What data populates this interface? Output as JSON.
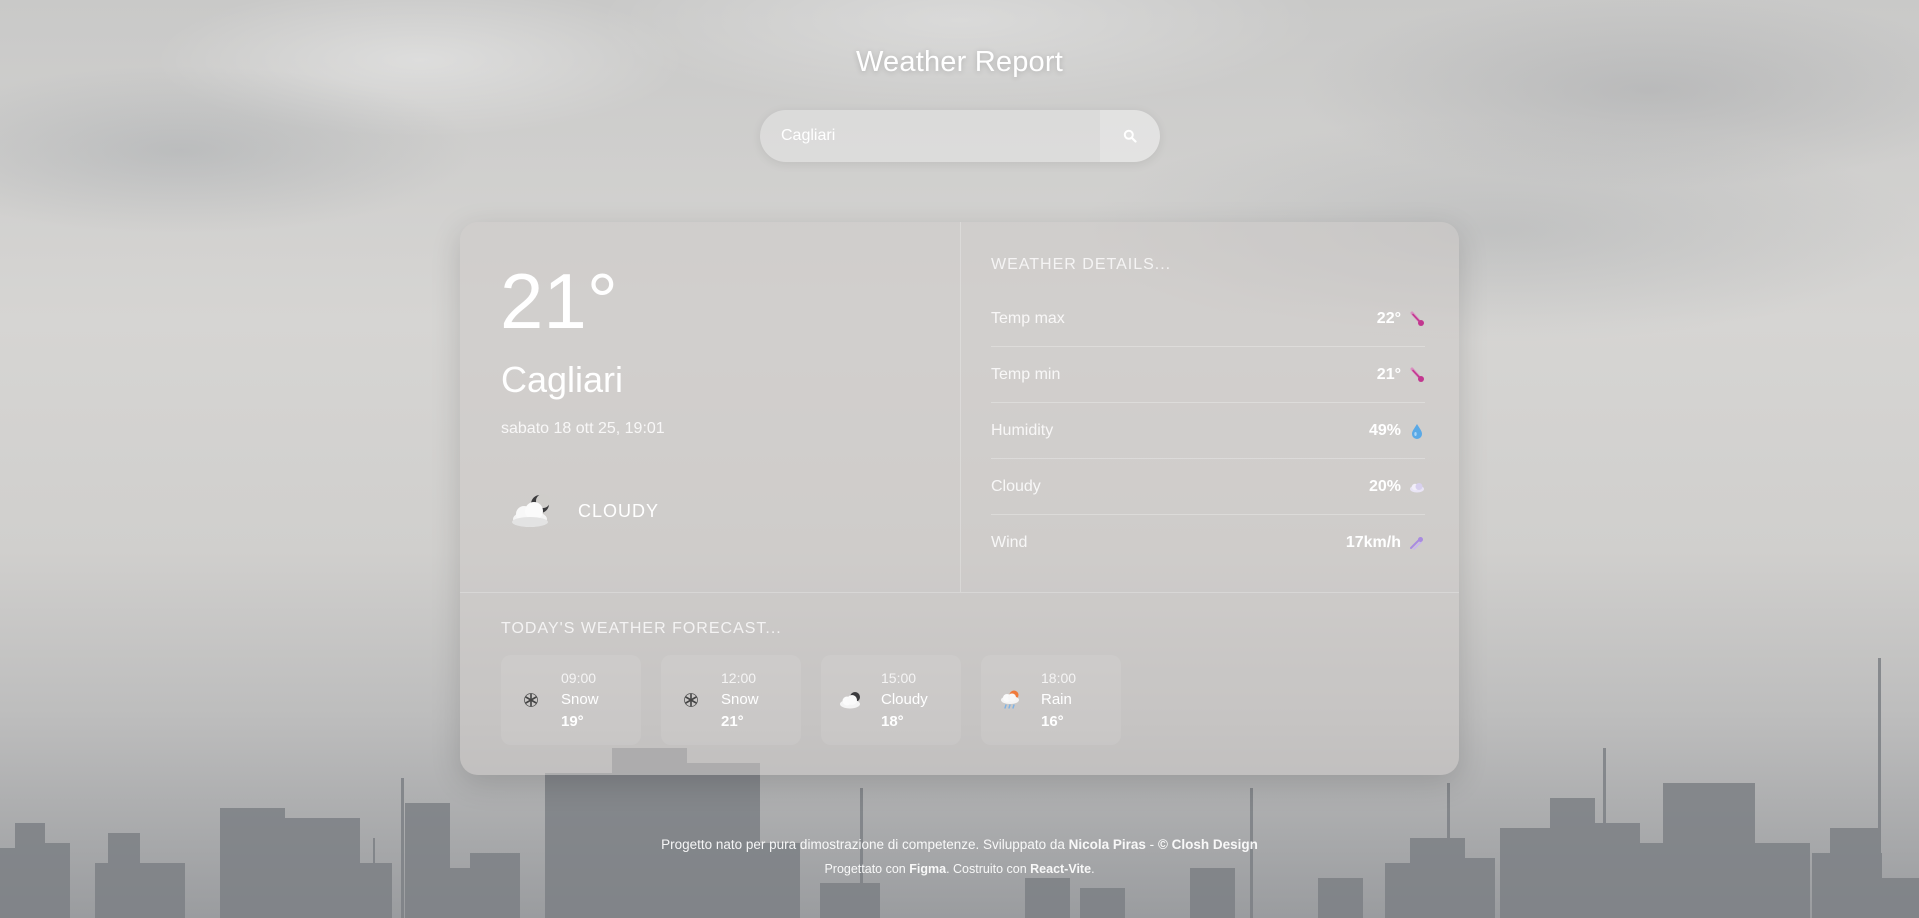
{
  "header": {
    "title": "Weather Report"
  },
  "search": {
    "value": "Cagliari",
    "placeholder": ""
  },
  "current": {
    "temperature": "21°",
    "city": "Cagliari",
    "datetime": "sabato 18 ott 25, 19:01",
    "condition": "CLOUDY",
    "condition_icon": "cloudy-night-icon"
  },
  "details": {
    "heading": "WEATHER DETAILS...",
    "rows": [
      {
        "label": "Temp max",
        "value": "22°",
        "icon": "thermometer-icon"
      },
      {
        "label": "Temp min",
        "value": "21°",
        "icon": "thermometer-icon"
      },
      {
        "label": "Humidity",
        "value": "49%",
        "icon": "droplet-icon"
      },
      {
        "label": "Cloudy",
        "value": "20%",
        "icon": "cloud-icon"
      },
      {
        "label": "Wind",
        "value": "17km/h",
        "icon": "wind-icon"
      }
    ]
  },
  "forecast": {
    "heading": "TODAY'S WEATHER FORECAST...",
    "items": [
      {
        "time": "09:00",
        "condition": "Snow",
        "temp": "19°",
        "icon": "snowflake-icon"
      },
      {
        "time": "12:00",
        "condition": "Snow",
        "temp": "21°",
        "icon": "snowflake-icon"
      },
      {
        "time": "15:00",
        "condition": "Cloudy",
        "temp": "18°",
        "icon": "cloud-icon"
      },
      {
        "time": "18:00",
        "condition": "Rain",
        "temp": "16°",
        "icon": "rain-cloud-icon"
      }
    ]
  },
  "footer": {
    "line1_prefix": "Progetto nato per pura dimostrazione di competenze. Sviluppato da",
    "author": "Nicola Piras",
    "line1_sep": "-",
    "studio": "© Closh Design",
    "line2_prefix": "Progettato con",
    "tool1": "Figma",
    "line2_mid": ". Costruito con",
    "tool2": "React-Vite",
    "line2_end": "."
  },
  "colors": {
    "accent_thermometer": "#c2378f",
    "accent_droplet": "#5aa9e6",
    "accent_wind": "#a98be0"
  }
}
